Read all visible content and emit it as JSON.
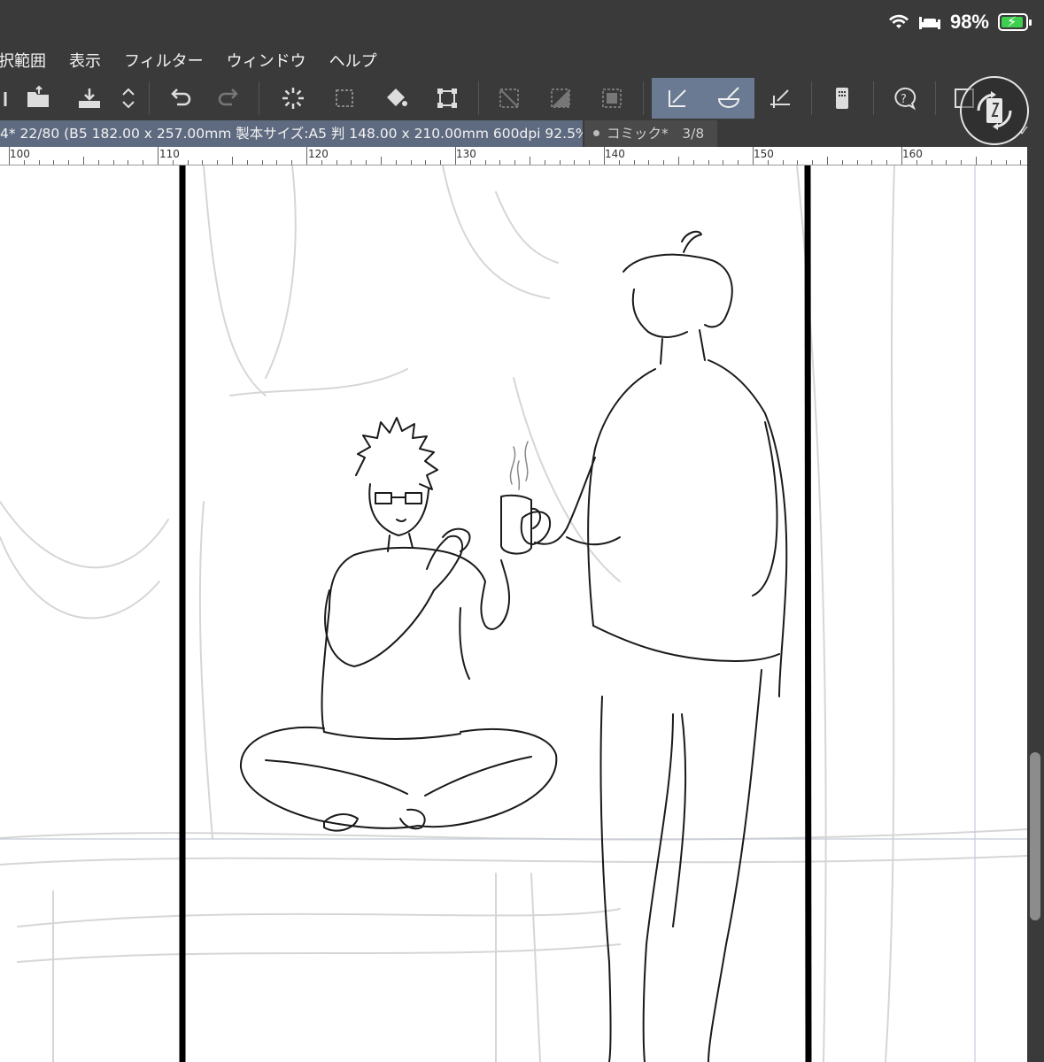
{
  "status": {
    "battery_percent": "98%",
    "battery_level": 0.98,
    "icons": [
      "wifi-icon",
      "sleep-bed-icon",
      "battery-charging-icon"
    ]
  },
  "menu": {
    "items": [
      "択範囲",
      "表示",
      "フィルター",
      "ウィンドウ",
      "ヘルプ"
    ]
  },
  "toolbar": {
    "icons": [
      "fill-menu-icon",
      "open-folder-icon",
      "save-icon",
      "up-down-arrows-icon",
      "undo-icon",
      "redo-icon",
      "deselect-icon",
      "select-all-icon",
      "fill-bucket-icon",
      "transform-icon",
      "clear-outside-icon",
      "fill-selection-icon",
      "convert-layer-icon",
      "pen-tool-icon",
      "brush-tool-icon",
      "ruler-tool-icon",
      "device-icon",
      "help-icon",
      "window-icon"
    ],
    "active_tools": [
      "pen-tool-icon",
      "brush-tool-icon"
    ]
  },
  "document_tab": {
    "active_label": "4* 22/80 (B5 182.00 x 257.00mm 製本サイズ:A5 判 148.00 x 210.00mm 600dpi 92.5%)",
    "inactive_label": "コミック*　3/8"
  },
  "ruler": {
    "labels": [
      "100",
      "110",
      "120",
      "130",
      "140",
      "150",
      "160"
    ]
  },
  "colors": {
    "chrome": "#3a3a3a",
    "active_tab": "#5e6a80",
    "active_tool": "#6a7a92",
    "canvas": "#ffffff"
  }
}
